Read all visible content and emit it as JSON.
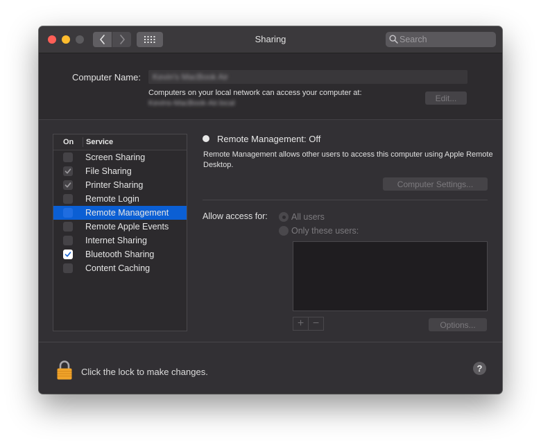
{
  "window": {
    "title": "Sharing"
  },
  "search": {
    "placeholder": "Search"
  },
  "computer_name": {
    "label": "Computer Name:",
    "value": "Kevin's MacBook Air",
    "description": "Computers on your local network can access your computer at:",
    "hostname": "Kevins-MacBook-Air.local",
    "edit_label": "Edit..."
  },
  "services": {
    "header_on": "On",
    "header_service": "Service",
    "items": [
      {
        "label": "Screen Sharing",
        "checked": false,
        "selected": false
      },
      {
        "label": "File Sharing",
        "checked": true,
        "selected": false
      },
      {
        "label": "Printer Sharing",
        "checked": true,
        "selected": false
      },
      {
        "label": "Remote Login",
        "checked": false,
        "selected": false
      },
      {
        "label": "Remote Management",
        "checked": false,
        "selected": true
      },
      {
        "label": "Remote Apple Events",
        "checked": false,
        "selected": false
      },
      {
        "label": "Internet Sharing",
        "checked": false,
        "selected": false
      },
      {
        "label": "Bluetooth Sharing",
        "checked": true,
        "selected": false
      },
      {
        "label": "Content Caching",
        "checked": false,
        "selected": false
      }
    ]
  },
  "detail": {
    "status": "Remote Management: Off",
    "description": "Remote Management allows other users to access this computer using Apple Remote Desktop.",
    "computer_settings_label": "Computer Settings...",
    "allow_access_label": "Allow access for:",
    "all_users_label": "All users",
    "only_these_users_label": "Only these users:",
    "add_label": "+",
    "remove_label": "−",
    "options_label": "Options..."
  },
  "footer": {
    "lock_text": "Click the lock to make changes.",
    "help_label": "?"
  },
  "colors": {
    "selection": "#0b5fd4",
    "close": "#ff5f57",
    "minimize": "#febc2e",
    "lock": "#f0a32a"
  }
}
